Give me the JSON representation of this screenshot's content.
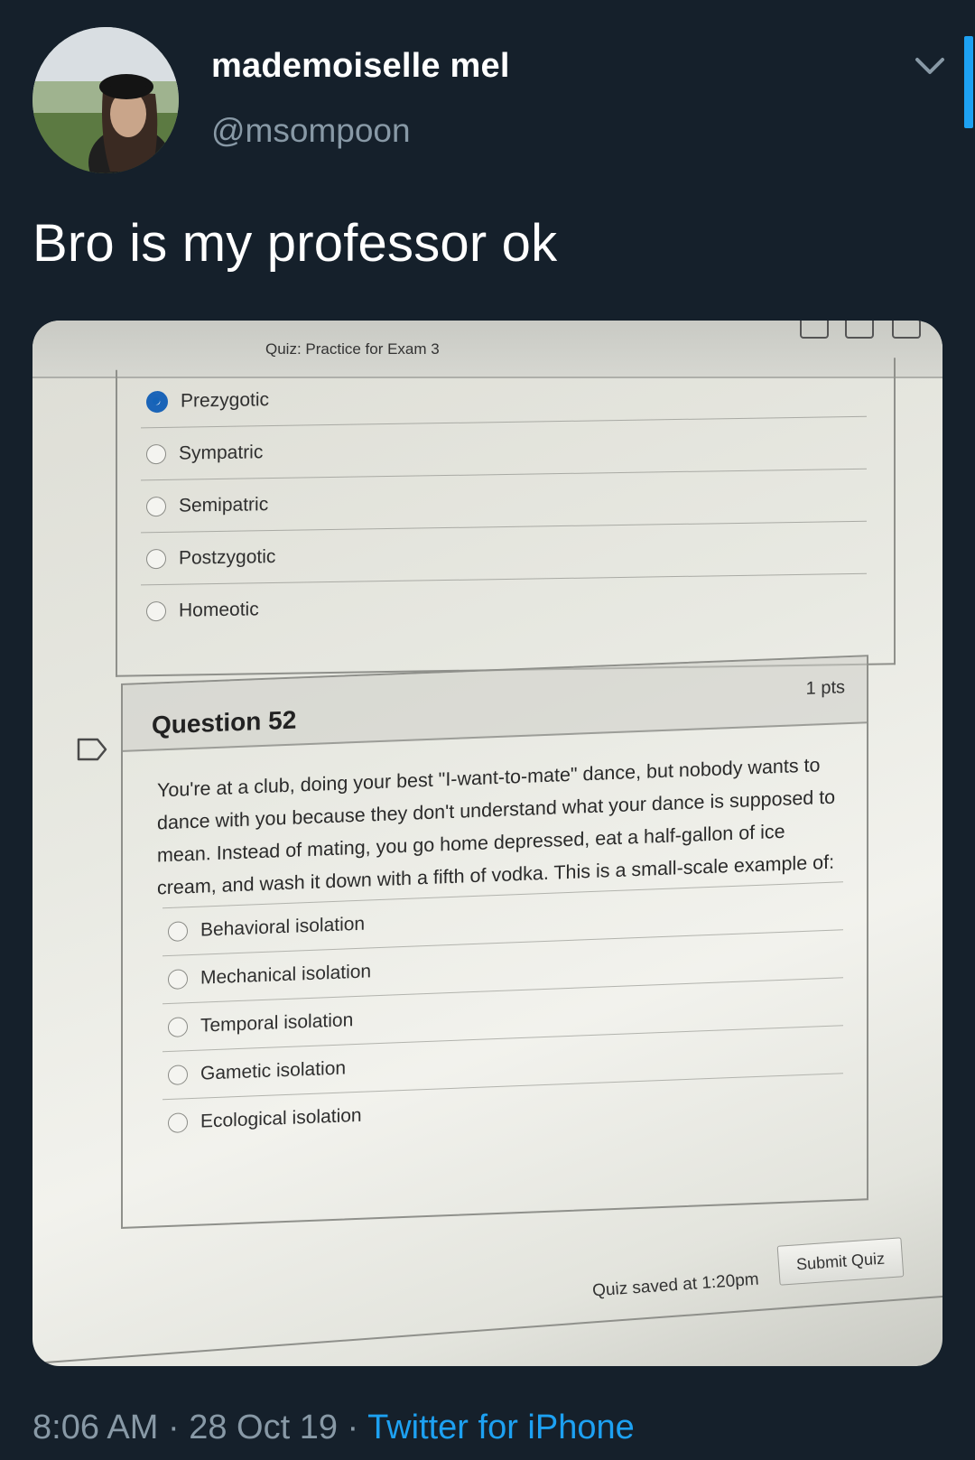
{
  "user": {
    "display_name": "mademoiselle mel",
    "handle": "@msompoon",
    "avatar": "profile-photo"
  },
  "tweet": {
    "text": "Bro is my professor ok"
  },
  "quiz": {
    "title": "Quiz: Practice for Exam 3",
    "previous_options": [
      {
        "label": "Prezygotic",
        "selected": true
      },
      {
        "label": "Sympatric",
        "selected": false
      },
      {
        "label": "Semipatric",
        "selected": false
      },
      {
        "label": "Postzygotic",
        "selected": false
      },
      {
        "label": "Homeotic",
        "selected": false
      }
    ],
    "question": {
      "number_label": "Question 52",
      "points": "1 pts",
      "text": "You're at a club, doing your best \"I-want-to-mate\" dance, but nobody wants to dance with you because they don't understand what your dance is supposed to mean. Instead of mating, you go home depressed, eat a half-gallon of ice cream, and wash it down with a fifth of vodka. This is a small-scale example of:",
      "options": [
        {
          "label": "Behavioral isolation"
        },
        {
          "label": "Mechanical isolation"
        },
        {
          "label": "Temporal isolation"
        },
        {
          "label": "Gametic isolation"
        },
        {
          "label": "Ecological isolation"
        }
      ]
    },
    "saved_status": "Quiz saved at 1:20pm",
    "submit_label": "Submit Quiz"
  },
  "meta": {
    "time": "8:06 AM",
    "separator": " · ",
    "date": "28 Oct 19",
    "source": "Twitter for iPhone"
  },
  "colors": {
    "background": "#15202b",
    "secondary_text": "#8899a6",
    "link": "#1da1f2",
    "radio_selected": "#1a64b8"
  }
}
